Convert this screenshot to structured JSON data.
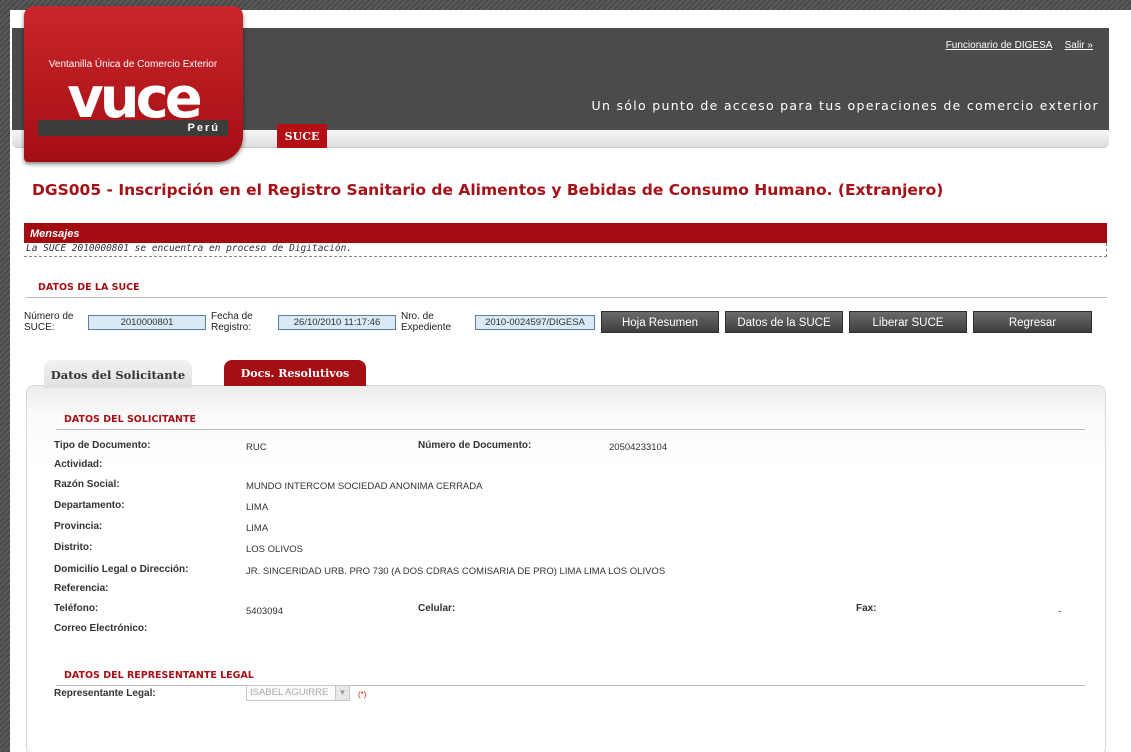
{
  "header": {
    "logo_top": "Ventanilla Única de Comercio Exterior",
    "logo_word": "vuce",
    "logo_country": "Perú",
    "user_link": "Funcionario de DIGESA",
    "logout_link": "Salir »",
    "tagline": "Un sólo punto de acceso para tus operaciones de comercio exterior",
    "nav_tab": "SUCE"
  },
  "page_title": "DGS005 - Inscripción en el Registro Sanitario de Alimentos y Bebidas de Consumo Humano. (Extranjero)",
  "messages": {
    "title": "Mensajes",
    "text": "La SUCE 2010000801 se encuentra en proceso de Digitación."
  },
  "suce": {
    "section_title": "DATOS DE LA SUCE",
    "numero_label": "Número de SUCE:",
    "numero_value": "2010000801",
    "fecha_label": "Fecha de Registro:",
    "fecha_value": "26/10/2010 11:17:46",
    "expediente_label": "Nro. de Expediente",
    "expediente_value": "2010-0024597/DIGESA",
    "buttons": [
      "Hoja Resumen",
      "Datos de la SUCE",
      "Liberar SUCE",
      "Regresar"
    ]
  },
  "tabs": [
    "Datos del Solicitante",
    "Docs. Resolutivos"
  ],
  "solicitante": {
    "section_title": "DATOS DEL SOLICITANTE",
    "tipo_doc_label": "Tipo de Documento:",
    "tipo_doc_value": "RUC",
    "num_doc_label": "Número de Documento:",
    "num_doc_value": "20504233104",
    "actividad_label": "Actividad:",
    "razon_label": "Razón Social:",
    "razon_value": "MUNDO INTERCOM SOCIEDAD ANONIMA CERRADA",
    "departamento_label": "Departamento:",
    "departamento_value": "LIMA",
    "provincia_label": "Provincia:",
    "provincia_value": "LIMA",
    "distrito_label": "Distrito:",
    "distrito_value": "LOS OLIVOS",
    "domicilio_label": "Domicilio Legal o Dirección:",
    "domicilio_value": "JR. SINCERIDAD URB. PRO 730 (A DOS CDRAS COMISARIA DE PRO) LIMA LIMA LOS OLIVOS",
    "referencia_label": "Referencia:",
    "telefono_label": "Teléfono:",
    "telefono_value": "5403094",
    "celular_label": "Celular:",
    "fax_label": "Fax:",
    "fax_value": "-",
    "correo_label": "Correo Electrónico:"
  },
  "representante": {
    "section_title": "DATOS DEL REPRESENTANTE LEGAL",
    "label": "Representante Legal:",
    "value": "ISABEL AGUIRRE",
    "required": "(*)"
  }
}
